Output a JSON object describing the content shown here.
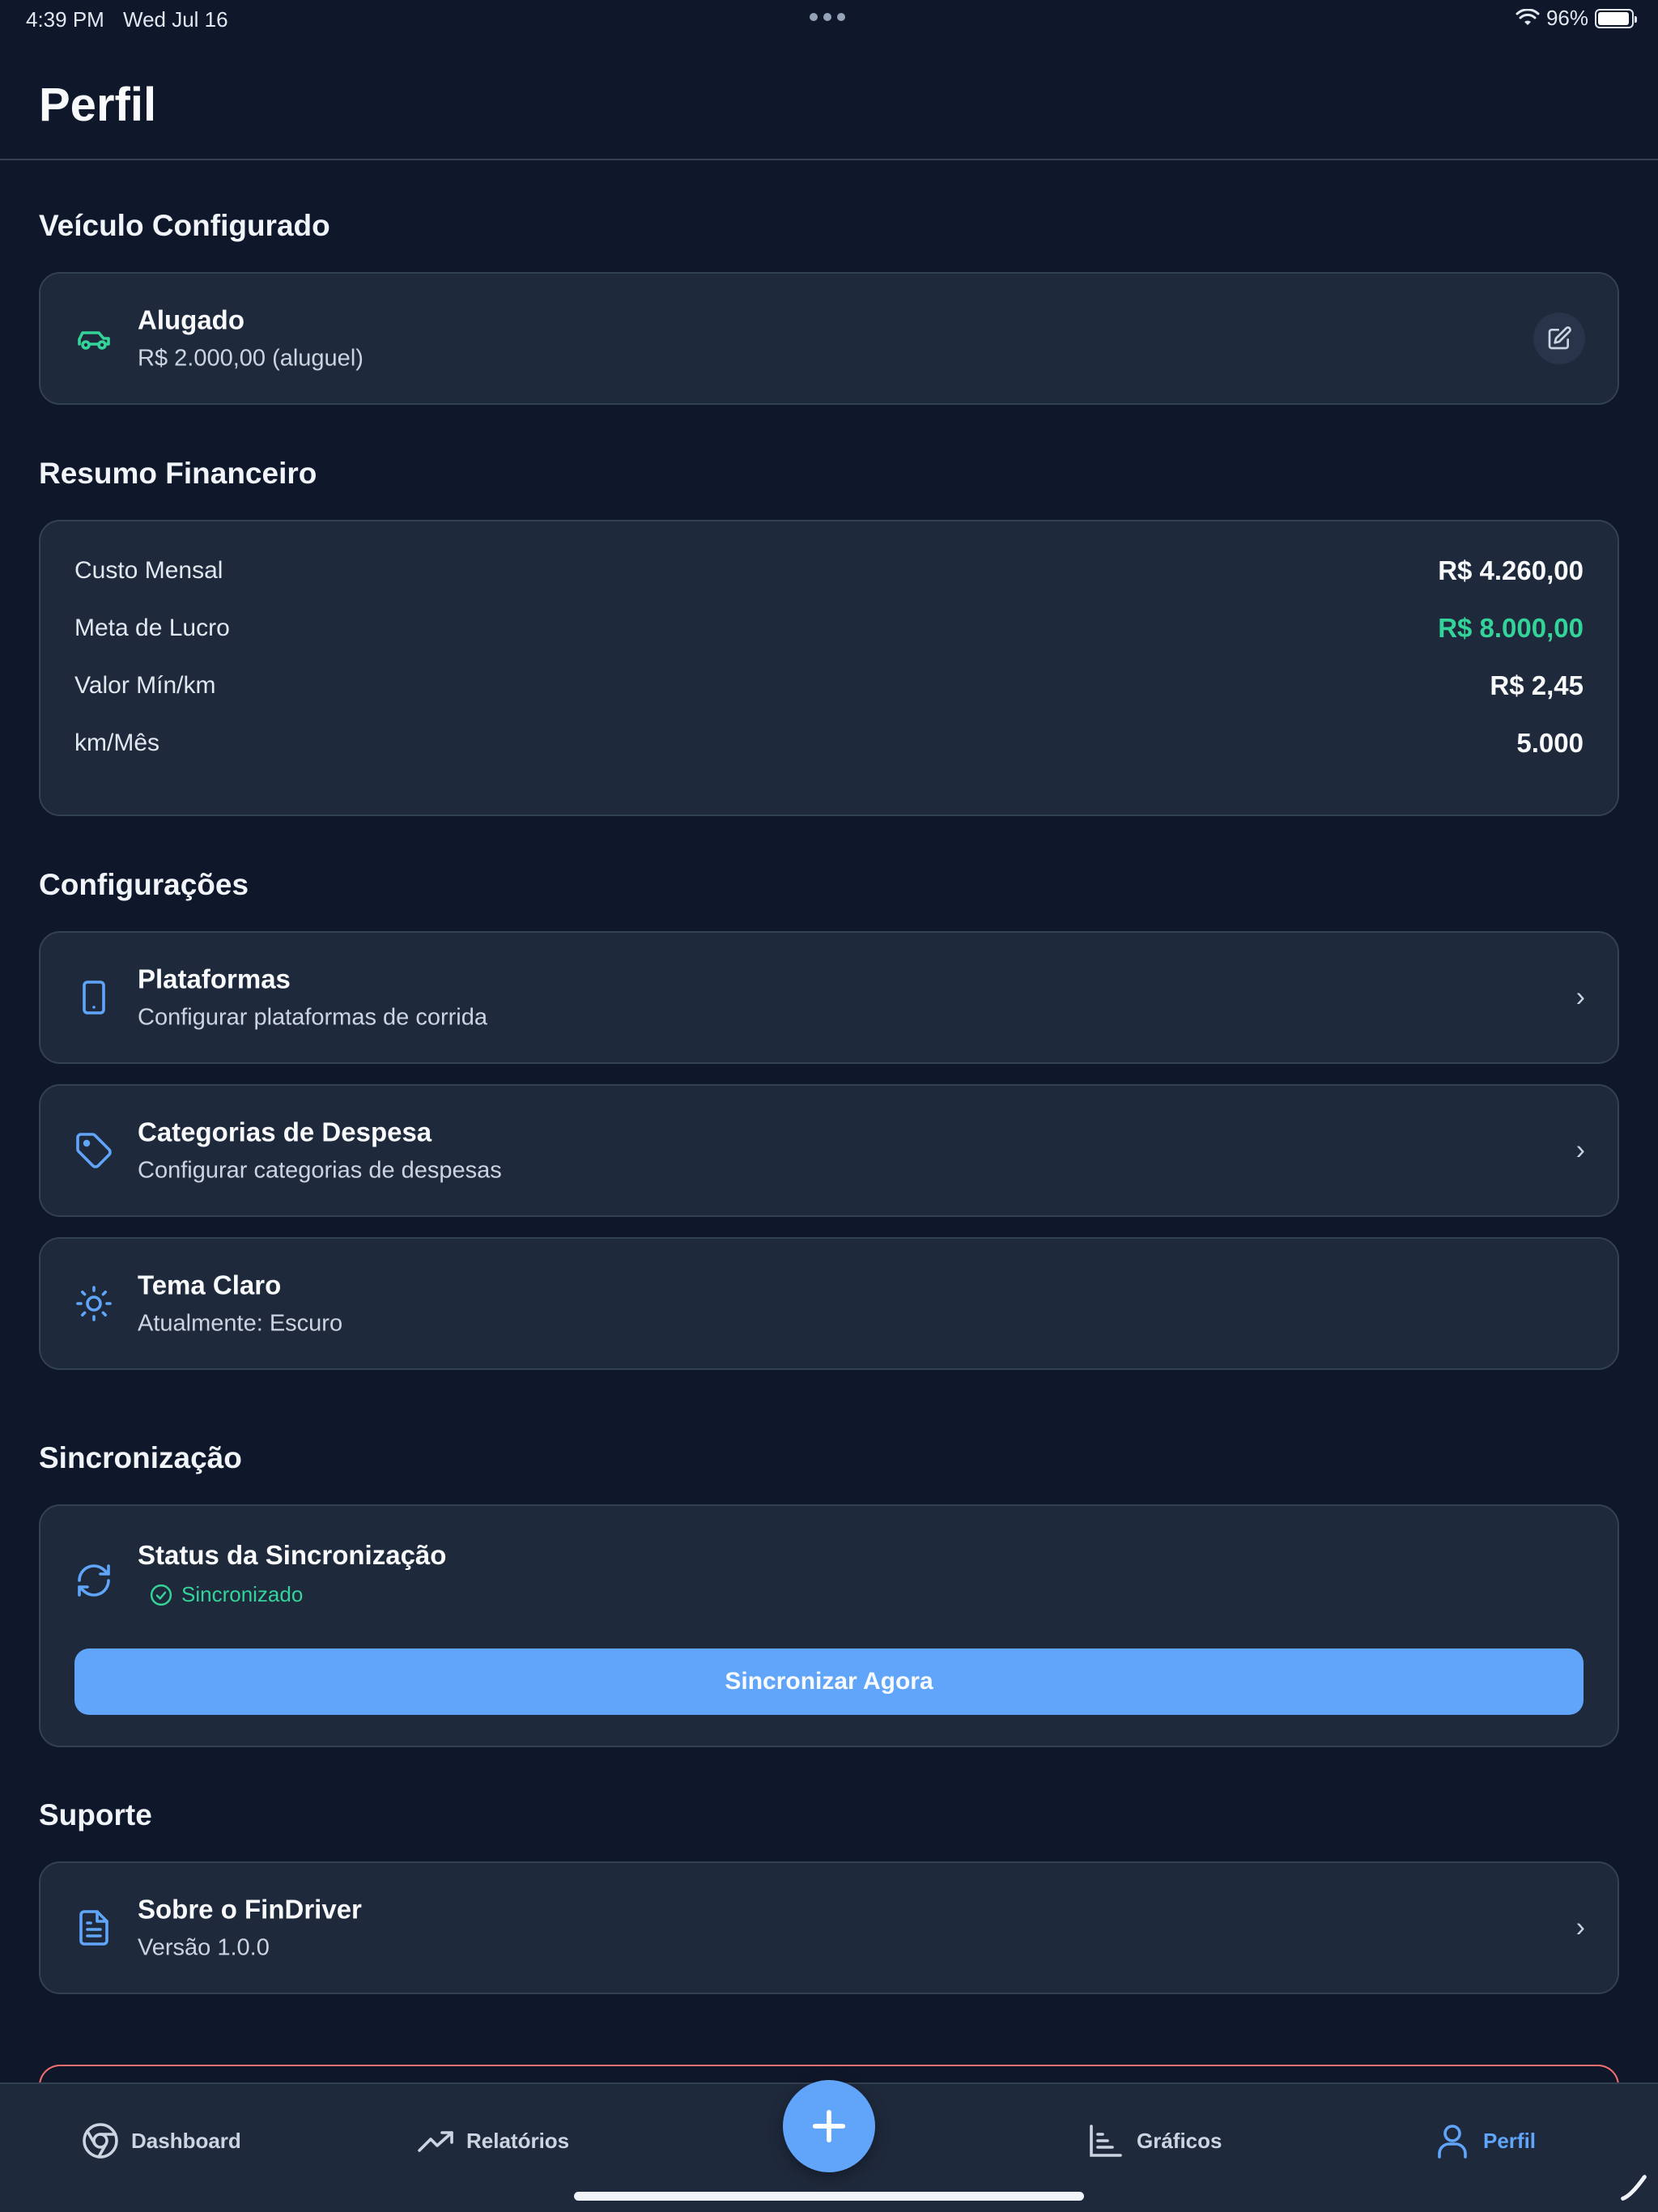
{
  "status_bar": {
    "time": "4:39 PM",
    "date": "Wed Jul 16",
    "battery": "96%",
    "battery_level": 0.96
  },
  "header": {
    "title": "Perfil"
  },
  "vehicle": {
    "section_title": "Veículo Configurado",
    "name": "Alugado",
    "detail": "R$ 2.000,00 (aluguel)",
    "icon": "car-icon",
    "icon_color": "#34d399"
  },
  "finance": {
    "section_title": "Resumo Financeiro",
    "rows": [
      {
        "label": "Custo Mensal",
        "value": "R$ 4.260,00"
      },
      {
        "label": "Meta de Lucro",
        "value": "R$ 8.000,00",
        "color": "#34d399"
      },
      {
        "label": "Valor Mín/km",
        "value": "R$ 2,45"
      },
      {
        "label": "km/Mês",
        "value": "5.000"
      }
    ]
  },
  "settings": {
    "section_title": "Configurações",
    "items": [
      {
        "title": "Plataformas",
        "subtitle": "Configurar plataformas de corrida",
        "icon": "smartphone-icon"
      },
      {
        "title": "Categorias de Despesa",
        "subtitle": "Configurar categorias de despesas",
        "icon": "tag-icon"
      },
      {
        "title": "Tema Claro",
        "subtitle": "Atualmente: Escuro",
        "icon": "sun-icon"
      }
    ]
  },
  "sync": {
    "section_title": "Sincronização",
    "title": "Status da Sincronização",
    "status": "Sincronizado",
    "button_label": "Sincronizar Agora"
  },
  "support": {
    "section_title": "Suporte",
    "items": [
      {
        "title": "Sobre o FinDriver",
        "subtitle": "Versão 1.0.0",
        "icon": "document-icon"
      }
    ]
  },
  "tabs": [
    {
      "label": "Dashboard",
      "icon": "dashboard-icon"
    },
    {
      "label": "Relatórios",
      "icon": "trending-up-icon"
    },
    {
      "label": "Gráficos",
      "icon": "bar-chart-icon"
    },
    {
      "label": "Perfil",
      "icon": "user-icon",
      "active": true
    }
  ],
  "colors": {
    "accent": "#60a5fa",
    "success": "#34d399",
    "danger": "#f87171",
    "background": "#0f172a",
    "card": "#1e293b"
  }
}
